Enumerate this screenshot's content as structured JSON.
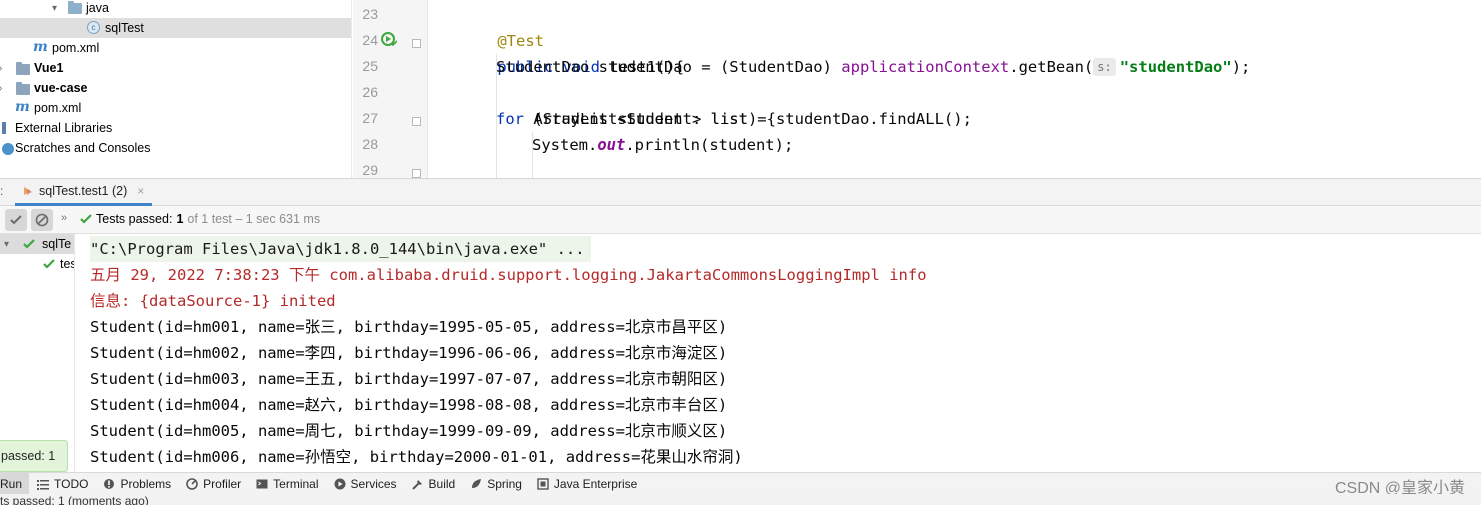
{
  "project_tree": {
    "items": [
      {
        "label": "java",
        "icon": "source-folder-icon"
      },
      {
        "label": "sqlTest",
        "icon": "test-class-icon"
      },
      {
        "label": "pom.xml",
        "icon": "maven-icon"
      },
      {
        "label": "Vue1",
        "icon": "folder-icon"
      },
      {
        "label": "vue-case",
        "icon": "folder-icon"
      },
      {
        "label": "pom.xml",
        "icon": "maven-icon"
      },
      {
        "label": "External Libraries",
        "icon": "library-icon"
      },
      {
        "label": "Scratches and Consoles",
        "icon": "scratch-icon"
      }
    ]
  },
  "editor": {
    "line_numbers": [
      "23",
      "24",
      "25",
      "26",
      "27",
      "28",
      "29"
    ],
    "code": {
      "l23_annotation": "@Test",
      "l24_kw1": "public",
      "l24_kw2": "void",
      "l24_rest": " test1(){",
      "l25_a": "StudentDao studentDao = (StudentDao) ",
      "l25_field": "applicationContext",
      "l25_b": ".getBean(",
      "l25_hint": "s:",
      "l25_str": "\"studentDao\"",
      "l25_c": ");",
      "l26": "ArrayList<Student> list = studentDao.findALL();",
      "l27_kw": "for",
      "l27_rest": " (Student student : list) {",
      "l28_a": "System.",
      "l28_out": "out",
      "l28_b": ".println(student);",
      "l29": "}"
    }
  },
  "run_panel": {
    "tab_label": "sqlTest.test1 (2)",
    "tab_close": "×",
    "status_label": "Tests passed:",
    "status_count": "1",
    "status_detail": "of 1 test – 1 sec 631 ms",
    "more": "»",
    "test_tree": {
      "root": "sqlTe",
      "child": "tes"
    },
    "console_lines": [
      "\"C:\\Program Files\\Java\\jdk1.8.0_144\\bin\\java.exe\" ...",
      "五月 29, 2022 7:38:23 下午 com.alibaba.druid.support.logging.JakartaCommonsLoggingImpl info",
      "信息: {dataSource-1} inited",
      "Student(id=hm001, name=张三, birthday=1995-05-05, address=北京市昌平区)",
      "Student(id=hm002, name=李四, birthday=1996-06-06, address=北京市海淀区)",
      "Student(id=hm003, name=王五, birthday=1997-07-07, address=北京市朝阳区)",
      "Student(id=hm004, name=赵六, birthday=1998-08-08, address=北京市丰台区)",
      "Student(id=hm005, name=周七, birthday=1999-09-09, address=北京市顺义区)",
      "Student(id=hm006, name=孙悟空, birthday=2000-01-01, address=花果山水帘洞)"
    ],
    "popup": "passed: 1"
  },
  "tool_windows": [
    {
      "label": "Run",
      "icon": "run-icon"
    },
    {
      "label": "TODO",
      "icon": "todo-icon"
    },
    {
      "label": "Problems",
      "icon": "problems-icon"
    },
    {
      "label": "Profiler",
      "icon": "profiler-icon"
    },
    {
      "label": "Terminal",
      "icon": "terminal-icon"
    },
    {
      "label": "Services",
      "icon": "services-icon"
    },
    {
      "label": "Build",
      "icon": "build-icon"
    },
    {
      "label": "Spring",
      "icon": "spring-icon"
    },
    {
      "label": "Java Enterprise",
      "icon": "java-enterprise-icon"
    }
  ],
  "watermark": "CSDN @皇家小黄",
  "status_bar": {
    "text": "ts passed: 1 (moments ago)"
  },
  "colors": {
    "pass_green": "#3ea63e",
    "accent_blue": "#4083c9",
    "error_red": "#b52929"
  }
}
